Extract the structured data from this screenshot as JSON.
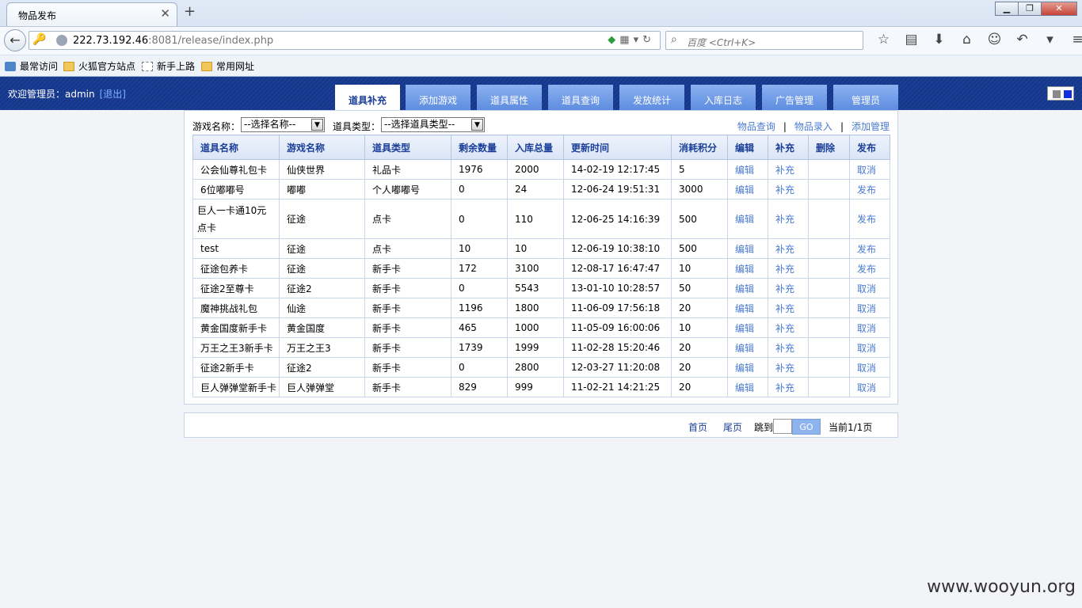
{
  "browser": {
    "tab_title": "物品发布",
    "tab_close": "✕",
    "new_tab": "+",
    "url_host": "222.73.192.46",
    "url_rest": ":8081/release/index.php",
    "search_placeholder": "百度 <Ctrl+K>",
    "window_buttons": [
      "▁",
      "❐",
      "✕"
    ],
    "bookmarks": [
      "最常访问",
      "火狐官方站点",
      "新手上路",
      "常用网址"
    ]
  },
  "header": {
    "welcome": "欢迎管理员：admin",
    "logout": "[退出]",
    "nav": [
      "道具补充",
      "添加游戏",
      "道具属性",
      "道具查询",
      "发放统计",
      "入库日志",
      "广告管理",
      "管理员"
    ]
  },
  "filters": {
    "game_label": "游戏名称：",
    "game_select": "--选择名称--",
    "type_label": "道具类型：",
    "type_select": "--选择道具类型--",
    "links": [
      "物品查询",
      "物品录入",
      "添加管理"
    ],
    "separator": "|"
  },
  "table": {
    "headers": [
      "道具名称",
      "游戏名称",
      "道具类型",
      "剩余数量",
      "入库总量",
      "更新时间",
      "消耗积分",
      "编辑",
      "补充",
      "删除",
      "发布"
    ],
    "rows": [
      [
        "公会仙尊礼包卡",
        "仙侠世界",
        "礼品卡",
        "1976",
        "2000",
        "14-02-19 12:17:45",
        "5",
        "编辑",
        "补充",
        "",
        "取消"
      ],
      [
        "6位嘟嘟号",
        "嘟嘟",
        "个人嘟嘟号",
        "0",
        "24",
        "12-06-24 19:51:31",
        "3000",
        "编辑",
        "补充",
        "",
        "发布"
      ],
      [
        "巨人一卡通10元点卡",
        "征途",
        "点卡",
        "0",
        "110",
        "12-06-25 14:16:39",
        "500",
        "编辑",
        "补充",
        "",
        "发布"
      ],
      [
        "test",
        "征途",
        "点卡",
        "10",
        "10",
        "12-06-19 10:38:10",
        "500",
        "编辑",
        "补充",
        "",
        "发布"
      ],
      [
        "征途包养卡",
        "征途",
        "新手卡",
        "172",
        "3100",
        "12-08-17 16:47:47",
        "10",
        "编辑",
        "补充",
        "",
        "发布"
      ],
      [
        "征途2至尊卡",
        "征途2",
        "新手卡",
        "0",
        "5543",
        "13-01-10 10:28:57",
        "50",
        "编辑",
        "补充",
        "",
        "取消"
      ],
      [
        "魔神挑战礼包",
        "仙途",
        "新手卡",
        "1196",
        "1800",
        "11-06-09 17:56:18",
        "20",
        "编辑",
        "补充",
        "",
        "取消"
      ],
      [
        "黄金国度新手卡",
        "黄金国度",
        "新手卡",
        "465",
        "1000",
        "11-05-09 16:00:06",
        "10",
        "编辑",
        "补充",
        "",
        "取消"
      ],
      [
        "万王之王3新手卡",
        "万王之王3",
        "新手卡",
        "1739",
        "1999",
        "11-02-28 15:20:46",
        "20",
        "编辑",
        "补充",
        "",
        "取消"
      ],
      [
        "征途2新手卡",
        "征途2",
        "新手卡",
        "0",
        "2800",
        "12-03-27 11:20:08",
        "20",
        "编辑",
        "补充",
        "",
        "取消"
      ],
      [
        "巨人弹弹堂新手卡",
        "巨人弹弹堂",
        "新手卡",
        "829",
        "999",
        "11-02-21 14:21:25",
        "20",
        "编辑",
        "补充",
        "",
        "取消"
      ]
    ]
  },
  "pager": {
    "first": "首页",
    "last": "尾页",
    "jump": "跳到",
    "go": "GO",
    "current": "当前1/1页"
  },
  "watermark": "www.wooyun.org"
}
